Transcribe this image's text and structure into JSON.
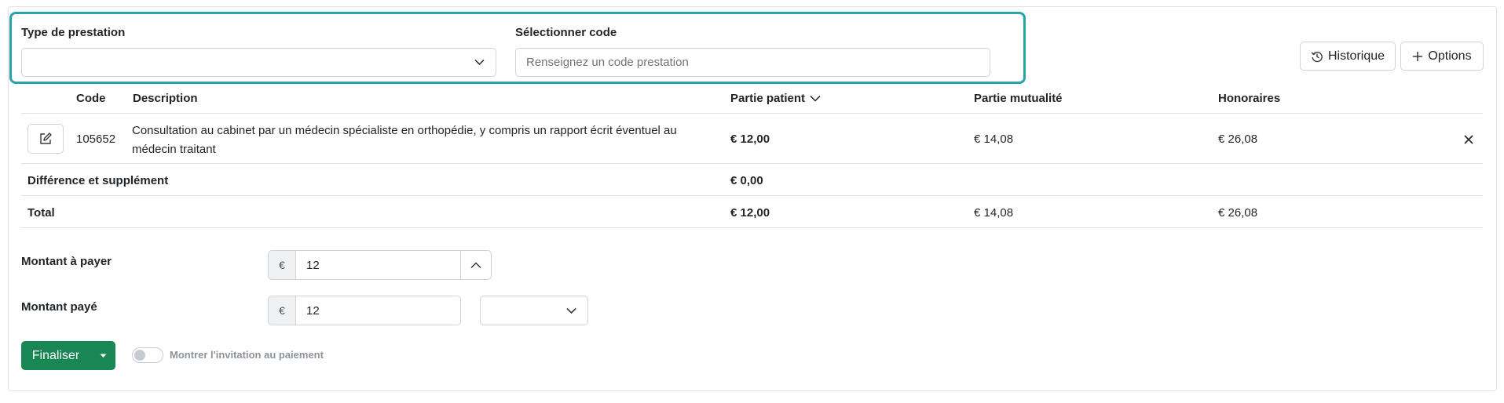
{
  "form": {
    "type_label": "Type de prestation",
    "type_value": "",
    "code_label": "Sélectionner code",
    "code_placeholder": "Renseignez un code prestation",
    "code_value": ""
  },
  "toolbar": {
    "history_label": "Historique",
    "history_icon": "history-icon",
    "options_label": "Options",
    "options_icon": "plus-icon"
  },
  "table": {
    "headers": {
      "code": "Code",
      "description": "Description",
      "patient": "Partie patient",
      "mutuality": "Partie mutualité",
      "fees": "Honoraires"
    },
    "sort_icon": "chevron-down-icon",
    "rows": [
      {
        "code": "105652",
        "description": "Consultation au cabinet par un médecin spécialiste en orthopédie, y compris un rapport écrit éventuel au médecin traitant",
        "patient": "€ 12,00",
        "mutuality": "€ 14,08",
        "fees": "€ 26,08"
      }
    ],
    "difference": {
      "label": "Différence et supplément",
      "patient": "€ 0,00"
    },
    "total": {
      "label": "Total",
      "patient": "€ 12,00",
      "mutuality": "€ 14,08",
      "fees": "€ 26,08"
    }
  },
  "payment": {
    "amount_due_label": "Montant à payer",
    "amount_due_currency": "€",
    "amount_due_value": "12",
    "amount_paid_label": "Montant payé",
    "amount_paid_currency": "€",
    "amount_paid_value": "12",
    "method_value": ""
  },
  "actions": {
    "finalize_label": "Finaliser",
    "toggle_label": "Montrer l'invitation au paiement",
    "toggle_on": false
  },
  "colors": {
    "highlight": "#27a4a7",
    "primary_green": "#198754"
  }
}
